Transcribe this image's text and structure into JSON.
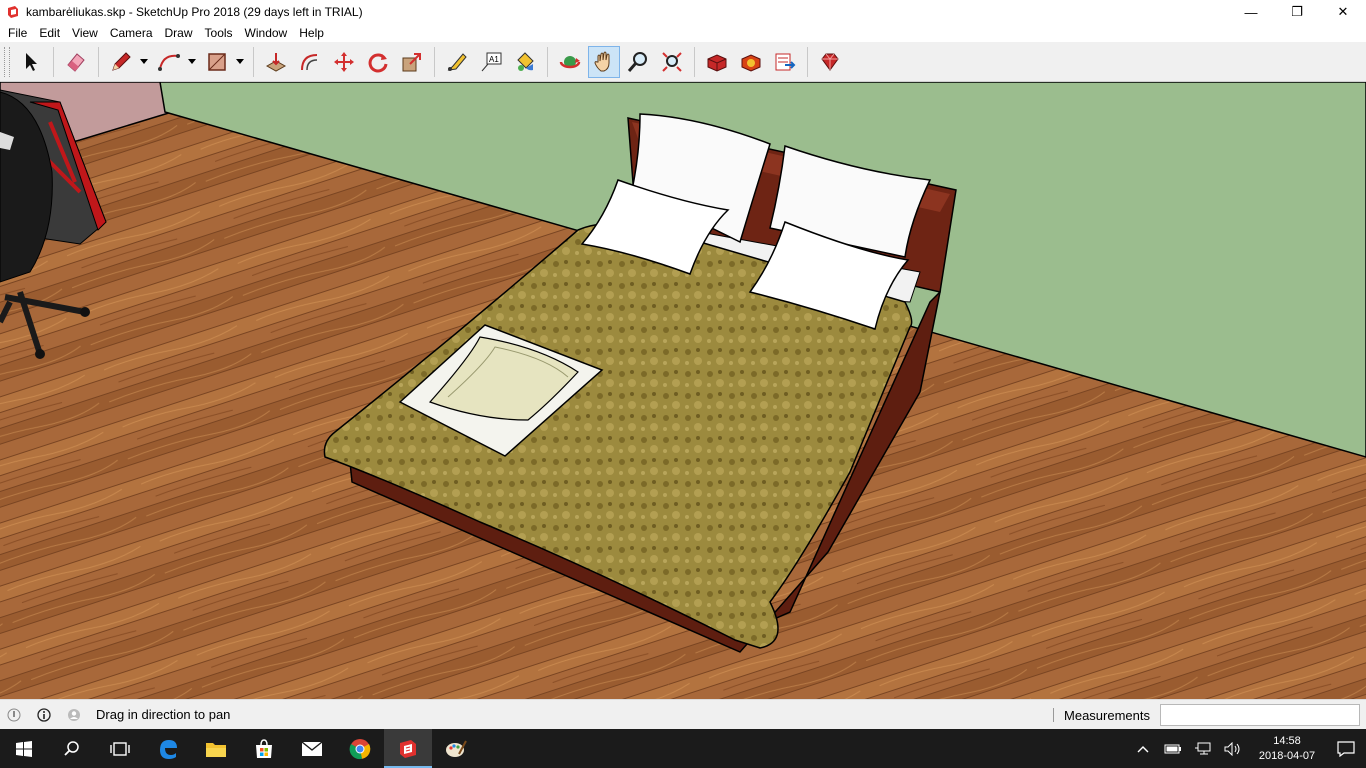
{
  "window": {
    "title": "kambarėliukas.skp - SketchUp Pro 2018 (29 days left in TRIAL)",
    "minimize": "—",
    "restore": "❐",
    "close": "✕"
  },
  "menu": [
    "File",
    "Edit",
    "View",
    "Camera",
    "Draw",
    "Tools",
    "Window",
    "Help"
  ],
  "toolbar": {
    "tools": [
      {
        "name": "select-tool",
        "icon": "arrow-cursor-icon"
      },
      {
        "name": "eraser-tool",
        "icon": "eraser-icon"
      },
      {
        "name": "line-tool",
        "icon": "pencil-icon"
      },
      {
        "name": "arc-tool",
        "icon": "arc-icon"
      },
      {
        "name": "rectangle-tool",
        "icon": "rectangle-icon"
      },
      {
        "name": "push-pull-tool",
        "icon": "push-pull-icon"
      },
      {
        "name": "offset-tool",
        "icon": "offset-icon"
      },
      {
        "name": "move-tool",
        "icon": "move-icon"
      },
      {
        "name": "rotate-tool",
        "icon": "rotate-icon"
      },
      {
        "name": "scale-tool",
        "icon": "scale-icon"
      },
      {
        "name": "tape-measure-tool",
        "icon": "tape-measure-icon"
      },
      {
        "name": "text-tool",
        "icon": "text-icon",
        "text": "A1"
      },
      {
        "name": "paint-bucket-tool",
        "icon": "paint-bucket-icon"
      },
      {
        "name": "orbit-tool",
        "icon": "orbit-icon"
      },
      {
        "name": "pan-tool",
        "icon": "pan-hand-icon",
        "active": true
      },
      {
        "name": "zoom-tool",
        "icon": "zoom-icon"
      },
      {
        "name": "zoom-extents-tool",
        "icon": "zoom-extents-icon"
      },
      {
        "name": "3d-warehouse",
        "icon": "warehouse-icon"
      },
      {
        "name": "extension-warehouse",
        "icon": "extension-warehouse-icon"
      },
      {
        "name": "send-to-layout",
        "icon": "layout-icon"
      },
      {
        "name": "extension-manager",
        "icon": "ruby-gem-icon"
      }
    ]
  },
  "status": {
    "hint": "Drag in direction to pan",
    "measurements_label": "Measurements",
    "measurements_value": ""
  },
  "taskbar": {
    "apps": [
      "windows-start-icon",
      "search-icon",
      "task-view-icon",
      "edge-icon",
      "file-explorer-icon",
      "store-icon",
      "mail-icon",
      "chrome-icon",
      "sketchup-icon",
      "paint-icon"
    ],
    "time": "14:58",
    "date": "2018-04-07"
  },
  "colors": {
    "wall_green": "#9bbd8e",
    "wall_pink": "#c29b9b",
    "floor_wood": "#a8683a",
    "bedspread": "#9c8a3e",
    "bed_frame": "#6e2414",
    "active_tool": "#cce4f7"
  }
}
